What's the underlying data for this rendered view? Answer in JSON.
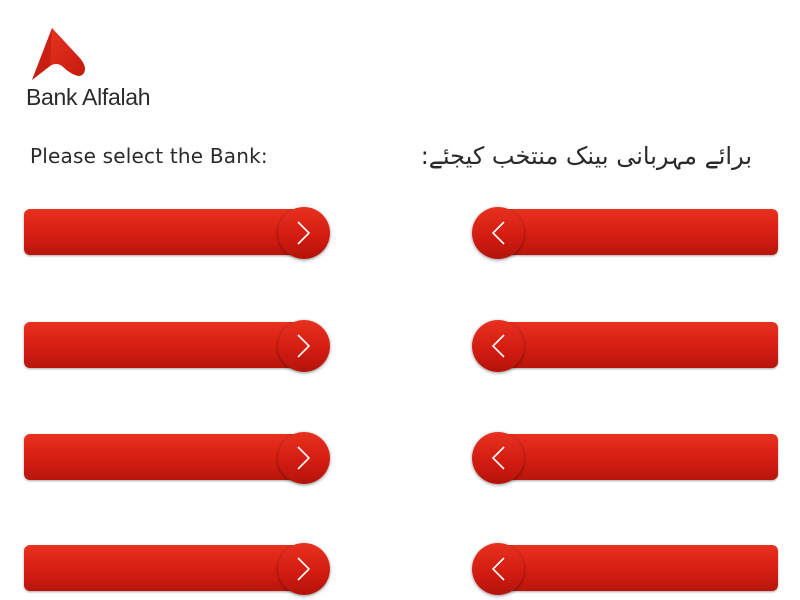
{
  "brand": {
    "name": "Bank Alfalah",
    "color": "#d6231a"
  },
  "prompt": {
    "english": "Please select the Bank:",
    "urdu": "برائے مہربانی بینک منتخب کیجئے:"
  },
  "left_buttons": [
    {
      "label": "",
      "icon": "chevron-right-icon"
    },
    {
      "label": "",
      "icon": "chevron-right-icon"
    },
    {
      "label": "",
      "icon": "chevron-right-icon"
    },
    {
      "label": "",
      "icon": "chevron-right-icon"
    }
  ],
  "right_buttons": [
    {
      "label": "",
      "icon": "chevron-left-icon"
    },
    {
      "label": "",
      "icon": "chevron-left-icon"
    },
    {
      "label": "",
      "icon": "chevron-left-icon"
    },
    {
      "label": "",
      "icon": "chevron-left-icon"
    }
  ]
}
